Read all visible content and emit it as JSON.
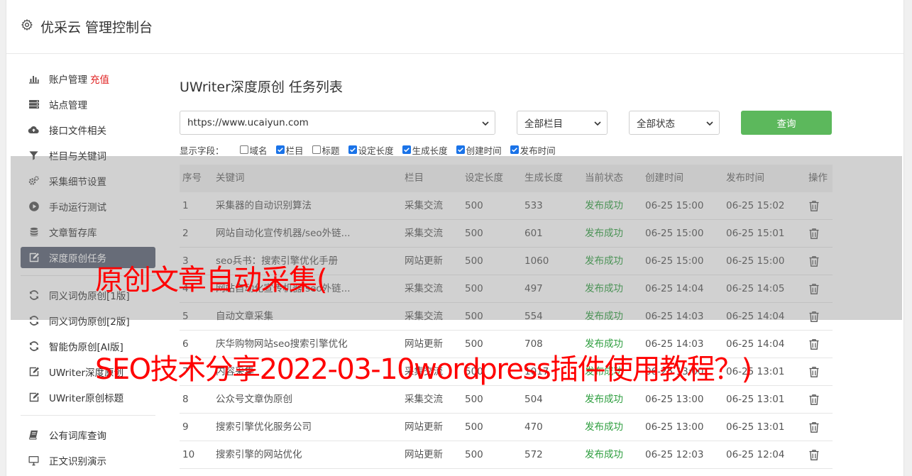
{
  "app": {
    "title": "优采云 管理控制台"
  },
  "sidebar": {
    "group1": [
      {
        "label": "账户管理",
        "icon": "bar-chart-icon",
        "badge": "充值"
      },
      {
        "label": "站点管理",
        "icon": "server-icon"
      },
      {
        "label": "接口文件相关",
        "icon": "cloud-upload-icon"
      },
      {
        "label": "栏目与关键词",
        "icon": "filter-icon"
      },
      {
        "label": "采集细节设置",
        "icon": "gears-icon"
      },
      {
        "label": "手动运行测试",
        "icon": "play-circle-icon"
      },
      {
        "label": "文章暂存库",
        "icon": "database-icon"
      },
      {
        "label": "深度原创任务",
        "icon": "edit-icon",
        "active": true
      }
    ],
    "group2": [
      {
        "label": "同义词伪原创[1版]",
        "icon": "refresh-icon"
      },
      {
        "label": "同义词伪原创[2版]",
        "icon": "refresh-icon"
      },
      {
        "label": "智能伪原创[AI版]",
        "icon": "refresh-icon"
      },
      {
        "label": "UWriter深度原创",
        "icon": "edit-icon"
      },
      {
        "label": "UWriter原创标题",
        "icon": "edit-icon"
      }
    ],
    "group3": [
      {
        "label": "公有词库查询",
        "icon": "book-icon"
      },
      {
        "label": "正文识别演示",
        "icon": "monitor-icon"
      }
    ]
  },
  "main": {
    "title": "UWriter深度原创 任务列表",
    "filters": {
      "site": "https://www.ucaiyun.com",
      "column": "全部栏目",
      "status": "全部状态",
      "query_label": "查询"
    },
    "fields_label": "显示字段：",
    "fields": [
      {
        "label": "域名",
        "checked": false
      },
      {
        "label": "栏目",
        "checked": true
      },
      {
        "label": "标题",
        "checked": false
      },
      {
        "label": "设定长度",
        "checked": true
      },
      {
        "label": "生成长度",
        "checked": true
      },
      {
        "label": "创建时间",
        "checked": true
      },
      {
        "label": "发布时间",
        "checked": true
      }
    ],
    "columns": [
      "序号",
      "关键词",
      "栏目",
      "设定长度",
      "生成长度",
      "当前状态",
      "创建时间",
      "发布时间",
      "操作"
    ],
    "rows": [
      [
        "1",
        "采集器的自动识别算法",
        "采集交流",
        "500",
        "533",
        "发布成功",
        "06-25 15:00",
        "06-25 15:02"
      ],
      [
        "2",
        "网站自动化宣传机器/seo外链...",
        "采集交流",
        "500",
        "601",
        "发布成功",
        "06-25 15:00",
        "06-25 15:01"
      ],
      [
        "3",
        "seo兵书：搜索引擎优化手册",
        "网站更新",
        "500",
        "1060",
        "发布成功",
        "06-25 15:00",
        "06-25 15:00"
      ],
      [
        "4",
        "网站自动化宣传机器/seo外链...",
        "采集交流",
        "500",
        "497",
        "发布成功",
        "06-25 14:04",
        "06-25 14:05"
      ],
      [
        "5",
        "自动文章采集",
        "采集交流",
        "500",
        "554",
        "发布成功",
        "06-25 14:03",
        "06-25 14:04"
      ],
      [
        "6",
        "庆华购物网站seo搜索引擎优化",
        "网站更新",
        "500",
        "708",
        "发布成功",
        "06-25 14:03",
        "06-25 14:04"
      ],
      [
        "7",
        "内容采集",
        "采集交流",
        "500",
        "1017",
        "发布成功",
        "06-25 13:00",
        "06-25 13:01"
      ],
      [
        "8",
        "公众号文章伪原创",
        "采集交流",
        "500",
        "504",
        "发布成功",
        "06-25 13:00",
        "06-25 13:01"
      ],
      [
        "9",
        "搜索引擎优化服务公司",
        "网站更新",
        "500",
        "470",
        "发布成功",
        "06-25 13:00",
        "06-25 13:01"
      ],
      [
        "10",
        "搜索引擎的网站优化",
        "网站更新",
        "500",
        "572",
        "发布成功",
        "06-25 12:03",
        "06-25 12:04"
      ]
    ]
  },
  "overlay": {
    "line1": "原创文章自动采集(",
    "line2": "SEO技术分享2022-03-10wordpress插件使用教程？)"
  },
  "colors": {
    "query_button": "#5cb85c",
    "status_success": "#2e9e3f",
    "active_nav": "#5a6274",
    "overlay_text": "#ff0000"
  }
}
